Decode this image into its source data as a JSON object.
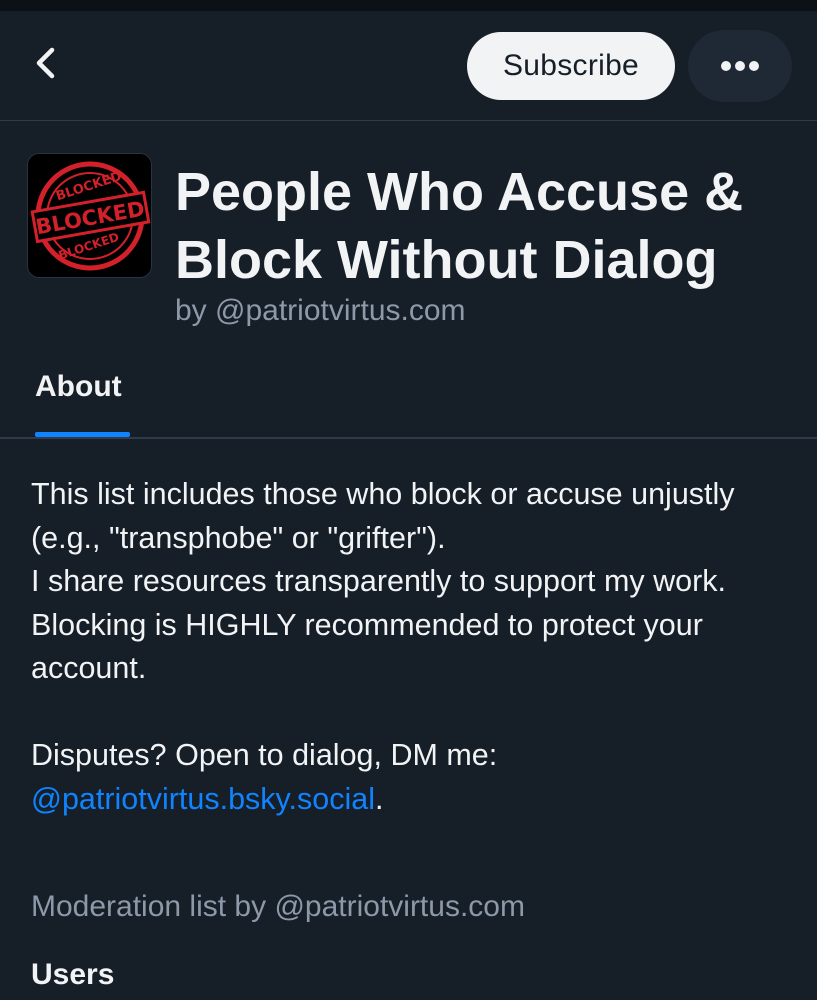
{
  "header": {
    "back_icon": "chevron-left-icon",
    "subscribe_label": "Subscribe",
    "more_icon": "ellipsis-icon"
  },
  "list": {
    "avatar_icon": "blocked-stamp-logo",
    "avatar_text": [
      "BLOCKED",
      "BLOCKED",
      "BLOCKED"
    ],
    "title": "People Who Accuse & Block Without Dialog",
    "byline": "by @patriotvirtus.com"
  },
  "tabs": [
    {
      "label": "About",
      "active": true
    }
  ],
  "about": {
    "lines": [
      "This list includes those who block or accuse unjustly (e.g., \"transphobe\" or \"grifter\").",
      "I share resources transparently to support my work.",
      "Blocking is HIGHLY recommended to protect your account."
    ],
    "disputes_text": "Disputes? Open to dialog, DM me:",
    "mention": "@patriotvirtus.bsky.social",
    "mention_suffix": ".",
    "moderation_line": "Moderation list by @patriotvirtus.com"
  },
  "sections": {
    "users_heading": "Users"
  },
  "colors": {
    "background": "#161e27",
    "accent": "#1083fe",
    "muted_text": "#8c99a8",
    "stamp_red": "#d3202a"
  }
}
